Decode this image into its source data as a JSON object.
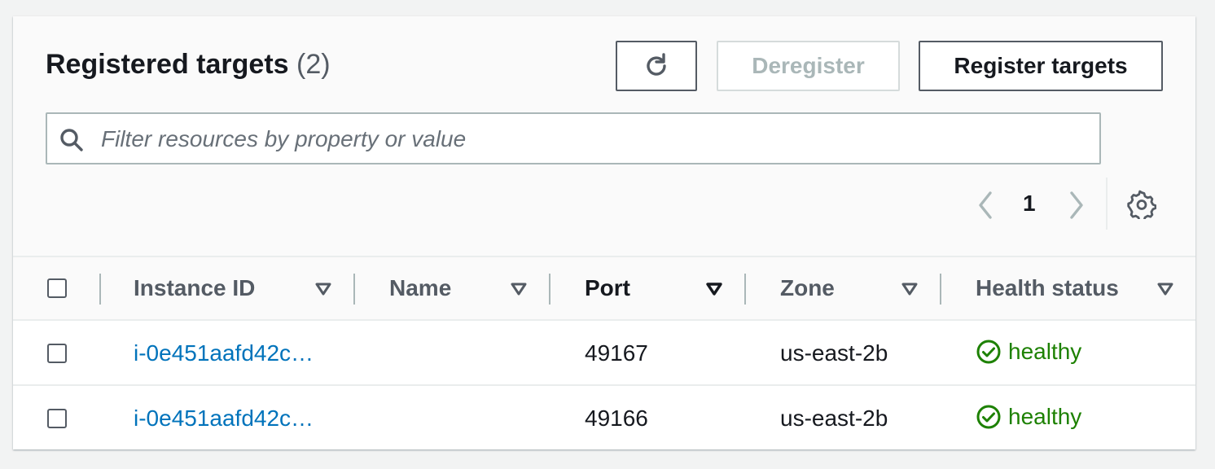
{
  "panel": {
    "title": "Registered targets",
    "count": "(2)",
    "deregister_label": "Deregister",
    "register_label": "Register targets"
  },
  "search": {
    "placeholder": "Filter resources by property or value",
    "value": ""
  },
  "pagination": {
    "current_page": "1"
  },
  "columns": [
    {
      "label": "Instance ID"
    },
    {
      "label": "Name"
    },
    {
      "label": "Port"
    },
    {
      "label": "Zone"
    },
    {
      "label": "Health status"
    }
  ],
  "rows": [
    {
      "instance_id": "i-0e451aafd42c…",
      "name": "",
      "port": "49167",
      "zone": "us-east-2b",
      "health": "healthy"
    },
    {
      "instance_id": "i-0e451aafd42c…",
      "name": "",
      "port": "49166",
      "zone": "us-east-2b",
      "health": "healthy"
    }
  ],
  "icons": {
    "refresh": "refresh-icon",
    "search": "search-icon",
    "prev": "chevron-left-icon",
    "next": "chevron-right-icon",
    "settings": "gear-icon",
    "sort": "caret-down-icon",
    "healthy": "check-circle-icon"
  },
  "colors": {
    "link": "#0073bb",
    "healthy": "#1d8102",
    "disabled": "#aab7b8"
  }
}
